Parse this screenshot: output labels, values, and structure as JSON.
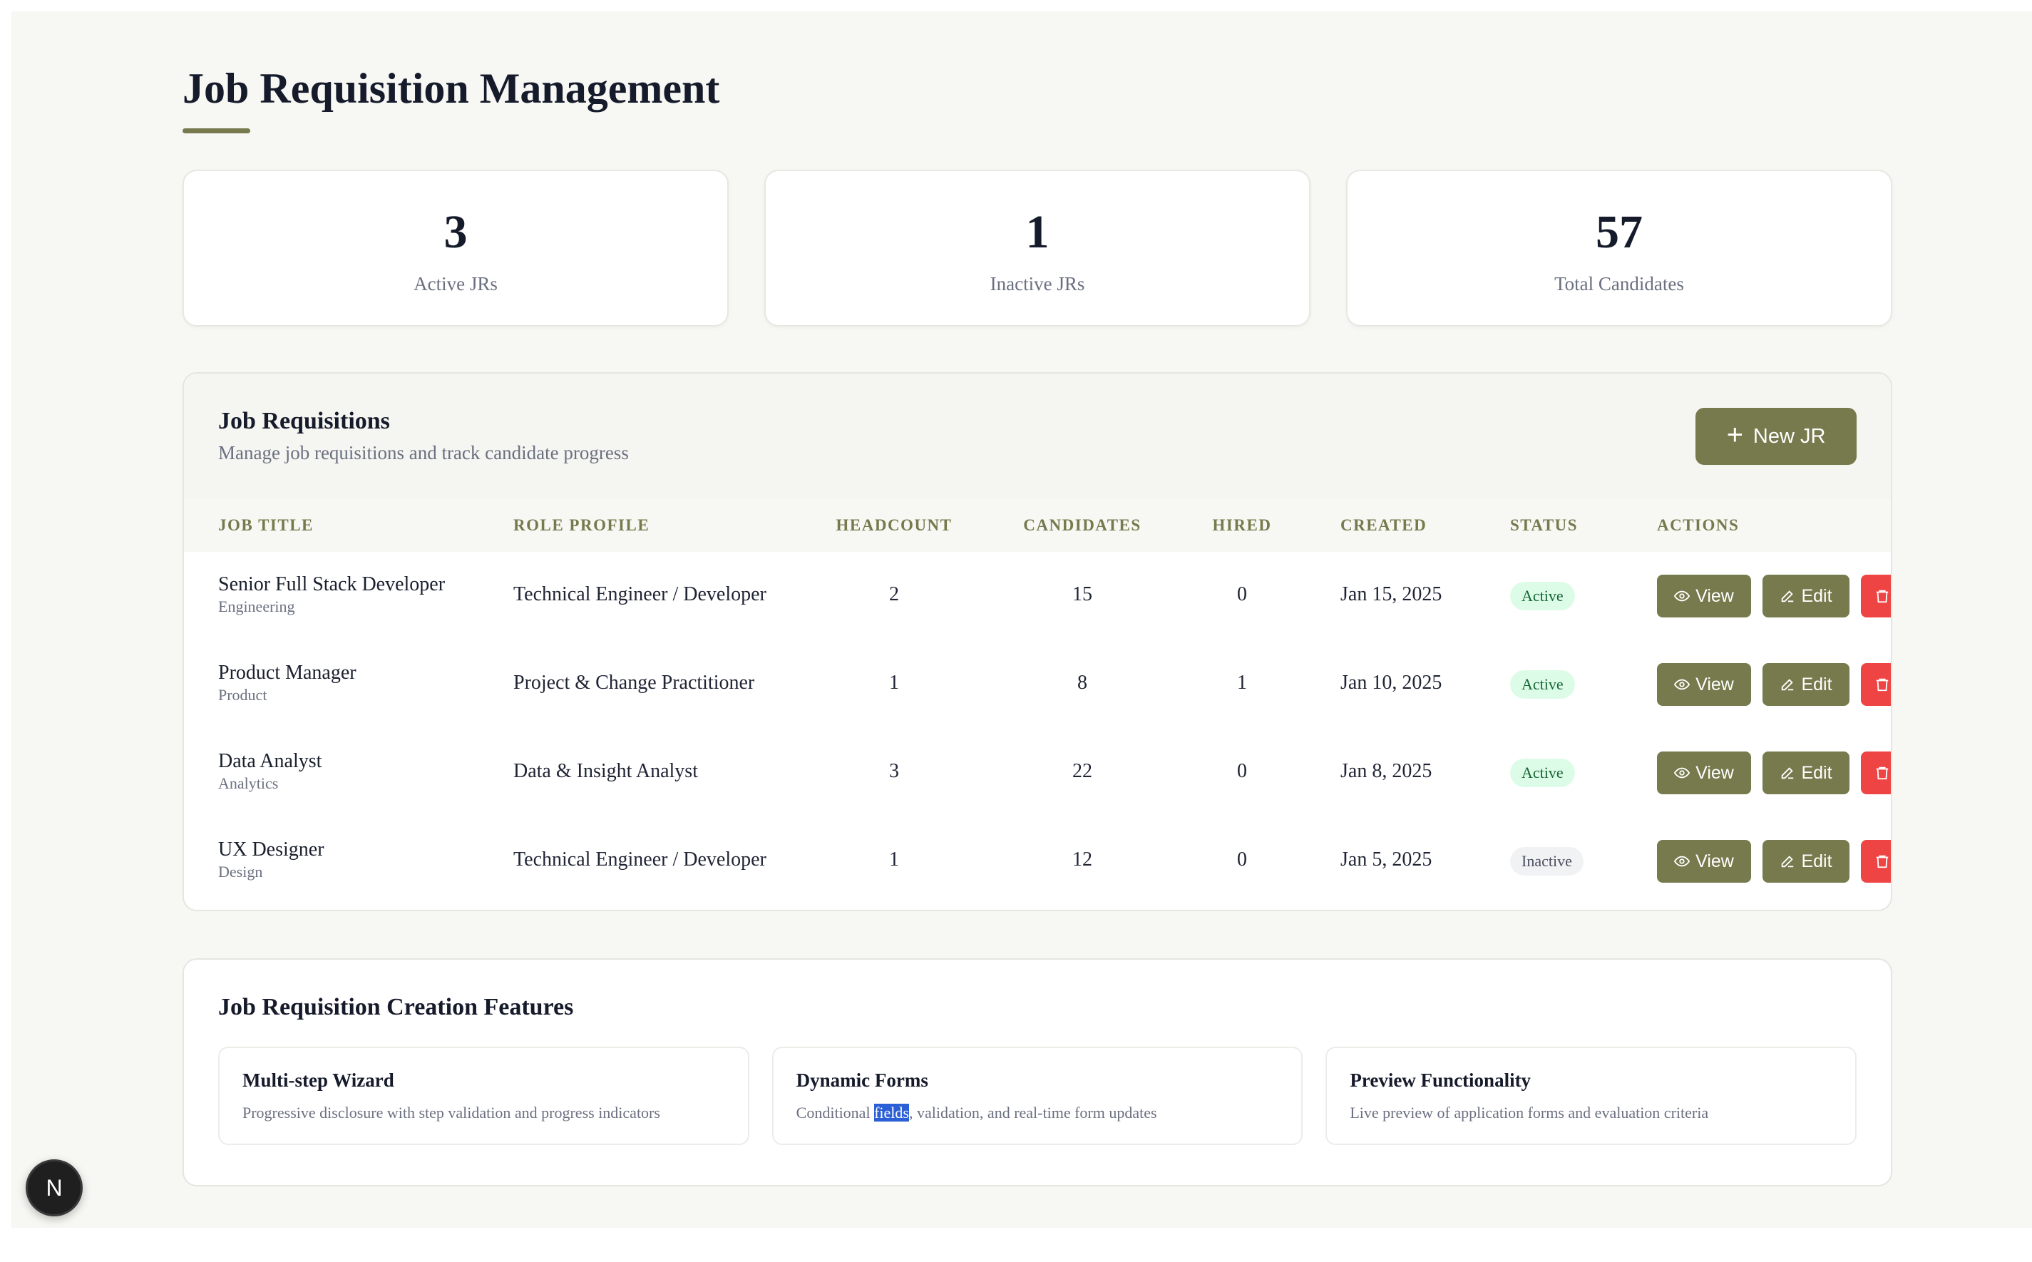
{
  "page": {
    "title": "Job Requisition Management"
  },
  "stats": [
    {
      "value": "3",
      "label": "Active JRs"
    },
    {
      "value": "1",
      "label": "Inactive JRs"
    },
    {
      "value": "57",
      "label": "Total Candidates"
    }
  ],
  "requisitions": {
    "title": "Job Requisitions",
    "subtitle": "Manage job requisitions and track candidate progress",
    "new_button_label": "New JR",
    "columns": [
      "JOB TITLE",
      "ROLE PROFILE",
      "HEADCOUNT",
      "CANDIDATES",
      "HIRED",
      "CREATED",
      "STATUS",
      "ACTIONS"
    ],
    "view_label": "View",
    "edit_label": "Edit",
    "rows": [
      {
        "title": "Senior Full Stack Developer",
        "department": "Engineering",
        "role_profile": "Technical Engineer / Developer",
        "headcount": "2",
        "candidates": "15",
        "hired": "0",
        "created": "Jan 15, 2025",
        "status": "Active"
      },
      {
        "title": "Product Manager",
        "department": "Product",
        "role_profile": "Project & Change Practitioner",
        "headcount": "1",
        "candidates": "8",
        "hired": "1",
        "created": "Jan 10, 2025",
        "status": "Active"
      },
      {
        "title": "Data Analyst",
        "department": "Analytics",
        "role_profile": "Data & Insight Analyst",
        "headcount": "3",
        "candidates": "22",
        "hired": "0",
        "created": "Jan 8, 2025",
        "status": "Active"
      },
      {
        "title": "UX Designer",
        "department": "Design",
        "role_profile": "Technical Engineer / Developer",
        "headcount": "1",
        "candidates": "12",
        "hired": "0",
        "created": "Jan 5, 2025",
        "status": "Inactive"
      }
    ]
  },
  "features": {
    "title": "Job Requisition Creation Features",
    "items": [
      {
        "name": "Multi-step Wizard",
        "description": "Progressive disclosure with step validation and progress indicators"
      },
      {
        "name": "Dynamic Forms",
        "desc_before": "Conditional ",
        "desc_highlight": "fields",
        "desc_after": ", validation, and real-time form updates"
      },
      {
        "name": "Preview Functionality",
        "description": "Live preview of application forms and evaluation criteria"
      }
    ]
  },
  "dev_badge": {
    "label": "N"
  },
  "colors": {
    "accent": "#767a4c",
    "danger": "#ef4444",
    "active_bg": "#dcfce7",
    "active_text": "#166534"
  }
}
